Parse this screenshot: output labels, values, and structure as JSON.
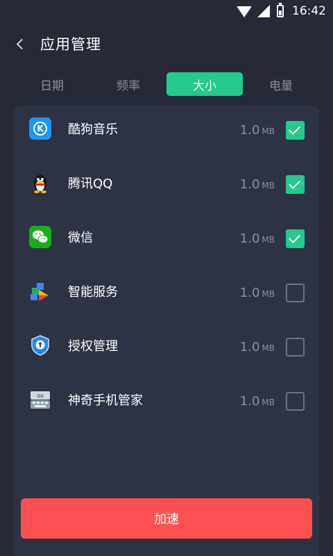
{
  "status_bar": {
    "time": "16:42"
  },
  "header": {
    "title": "应用管理"
  },
  "tabs": [
    {
      "label": "日期",
      "active": false
    },
    {
      "label": "频率",
      "active": false
    },
    {
      "label": "大小",
      "active": true
    },
    {
      "label": "电量",
      "active": false
    }
  ],
  "apps": [
    {
      "name": "酷狗音乐",
      "size": "1.0",
      "unit": "MB",
      "checked": true,
      "icon": "kugou-music-icon"
    },
    {
      "name": "腾讯QQ",
      "size": "1.0",
      "unit": "MB",
      "checked": true,
      "icon": "qq-penguin-icon"
    },
    {
      "name": "微信",
      "size": "1.0",
      "unit": "MB",
      "checked": true,
      "icon": "wechat-icon"
    },
    {
      "name": "智能服务",
      "size": "1.0",
      "unit": "MB",
      "checked": false,
      "icon": "google-play-services-icon"
    },
    {
      "name": "授权管理",
      "size": "1.0",
      "unit": "MB",
      "checked": false,
      "icon": "shield-lock-icon"
    },
    {
      "name": "神奇手机管家",
      "size": "1.0",
      "unit": "MB",
      "checked": false,
      "icon": "keyboard-icon"
    }
  ],
  "actions": {
    "speedup_label": "加速"
  },
  "colors": {
    "accent": "#24c98b",
    "danger": "#fc5052",
    "background": "#262a37",
    "card": "#2e3344"
  }
}
